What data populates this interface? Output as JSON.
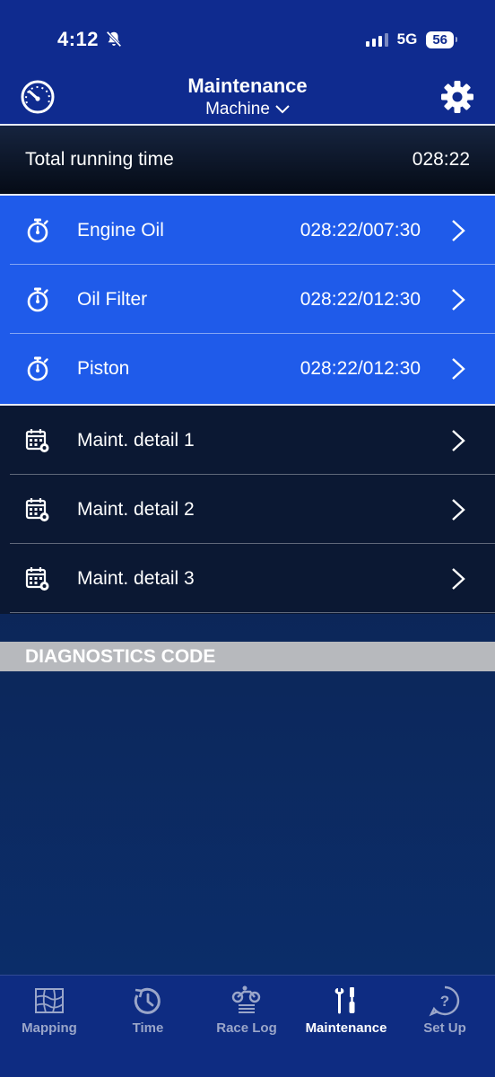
{
  "status_bar": {
    "time": "4:12",
    "network": "5G",
    "battery": "56"
  },
  "header": {
    "title": "Maintenance",
    "subtitle": "Machine",
    "left_icon": "speedometer-icon",
    "right_icon": "gear-icon"
  },
  "total": {
    "label": "Total running time",
    "value": "028:22"
  },
  "timers": [
    {
      "label": "Engine Oil",
      "value": "028:22/007:30",
      "icon": "stopwatch-icon"
    },
    {
      "label": "Oil Filter",
      "value": "028:22/012:30",
      "icon": "stopwatch-icon"
    },
    {
      "label": "Piston",
      "value": "028:22/012:30",
      "icon": "stopwatch-icon"
    }
  ],
  "details": [
    {
      "label": "Maint. detail 1",
      "icon": "calendar-gear-icon"
    },
    {
      "label": "Maint. detail 2",
      "icon": "calendar-gear-icon"
    },
    {
      "label": "Maint. detail 3",
      "icon": "calendar-gear-icon"
    }
  ],
  "diagnostics": {
    "label": "DIAGNOSTICS CODE"
  },
  "tabs": [
    {
      "label": "Mapping",
      "icon": "map-grid-icon",
      "active": false
    },
    {
      "label": "Time",
      "icon": "clock-icon",
      "active": false
    },
    {
      "label": "Race Log",
      "icon": "motorcycle-icon",
      "active": false
    },
    {
      "label": "Maintenance",
      "icon": "wrench-screwdriver-icon",
      "active": true
    },
    {
      "label": "Set Up",
      "icon": "help-icon",
      "active": false
    }
  ],
  "colors": {
    "header_bg": "#0f2b8f",
    "timer_rows_bg": "#1f5bea",
    "detail_rows_bg": "#0b1833",
    "diagnostics_bg": "#b7b9bd",
    "tabbar_bg": "#0e2c82",
    "tab_inactive": "#9aa6c9",
    "tab_active": "#ffffff"
  }
}
